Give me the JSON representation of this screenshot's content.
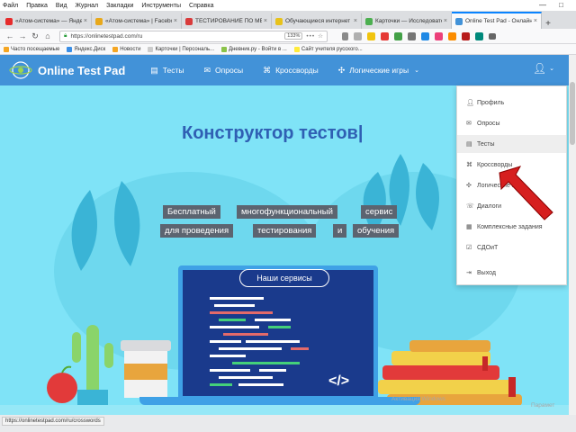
{
  "menubar": [
    "Файл",
    "Правка",
    "Вид",
    "Журнал",
    "Закладки",
    "Инструменты",
    "Справка"
  ],
  "window_controls": "— □",
  "tabs": [
    {
      "label": "«Атом-система» — Яндекс.Б",
      "color": "#e62b2b",
      "active": false
    },
    {
      "label": "«Атом-система» | Facebook",
      "color": "#e8a81a",
      "active": false
    },
    {
      "label": "ТЕСТИРОВАНИЕ ПО МЕТОД",
      "color": "#d93b3b",
      "active": false
    },
    {
      "label": "Обучающиеся интернет",
      "color": "#e8c21a",
      "active": false
    },
    {
      "label": "Карточки — Исследователь",
      "color": "#4caf50",
      "active": false
    },
    {
      "label": "Online Test Pad - Онлайн кон",
      "color": "#4292d8",
      "active": true
    }
  ],
  "toolbar": {
    "url": "https://onlinetestpad.com/ru",
    "zoom": "133%",
    "more": "•••"
  },
  "bookmarks": [
    {
      "label": "Часто посещаемые",
      "color": "#f5a623"
    },
    {
      "label": "Яндекс.Диск",
      "color": "#3a8ee6"
    },
    {
      "label": "Новости",
      "color": "#f5a623"
    },
    {
      "label": "Карточки | Персональ...",
      "color": "#cccccc"
    },
    {
      "label": "Дневник.ру - Войти в ...",
      "color": "#8bc34a"
    },
    {
      "label": "Сайт учителя русского...",
      "color": "#ffeb3b"
    }
  ],
  "site": {
    "brand": "Online Test Pad",
    "nav": [
      {
        "label": "Тесты",
        "icon": "list-icon"
      },
      {
        "label": "Опросы",
        "icon": "chat-icon"
      },
      {
        "label": "Кроссворды",
        "icon": "puzzle-icon"
      },
      {
        "label": "Логические игры",
        "icon": "gamepad-icon"
      }
    ],
    "headline": "Конструктор тестов|",
    "tags_row1": [
      "Бесплатный",
      "многофункциональный",
      "сервис"
    ],
    "tags_row2": [
      "для проведения",
      "тестирования",
      "и",
      "обучения"
    ],
    "services_pill": "Наши сервисы",
    "code_tag": "</>"
  },
  "dropdown": {
    "items": [
      {
        "label": "Профиль",
        "icon": "user-icon",
        "highlighted": false
      },
      {
        "label": "Опросы",
        "icon": "chat-icon",
        "highlighted": false
      },
      {
        "label": "Тесты",
        "icon": "list-icon",
        "highlighted": true
      },
      {
        "label": "Кроссворды",
        "icon": "puzzle-icon",
        "highlighted": false
      },
      {
        "label": "Логические игры",
        "icon": "gamepad-icon",
        "highlighted": false
      },
      {
        "label": "Диалоги",
        "icon": "dialog-icon",
        "highlighted": false
      },
      {
        "label": "Комплексные задания",
        "icon": "tasks-icon",
        "highlighted": false
      },
      {
        "label": "СДОиТ",
        "icon": "checkbox-icon",
        "highlighted": false
      },
      {
        "label": "Выход",
        "icon": "logout-icon",
        "highlighted": false
      }
    ]
  },
  "status_url": "https://onlinetestpad.com/ru/crosswords",
  "watermark": "Активация Windows",
  "watermark2": "Парамет",
  "colors": {
    "page_bg": "#7fe3f7",
    "nav_bg": "#4292d8",
    "headline": "#2f5fb3",
    "tag_bg": "#5c6470",
    "arrow": "#d61f1f"
  }
}
